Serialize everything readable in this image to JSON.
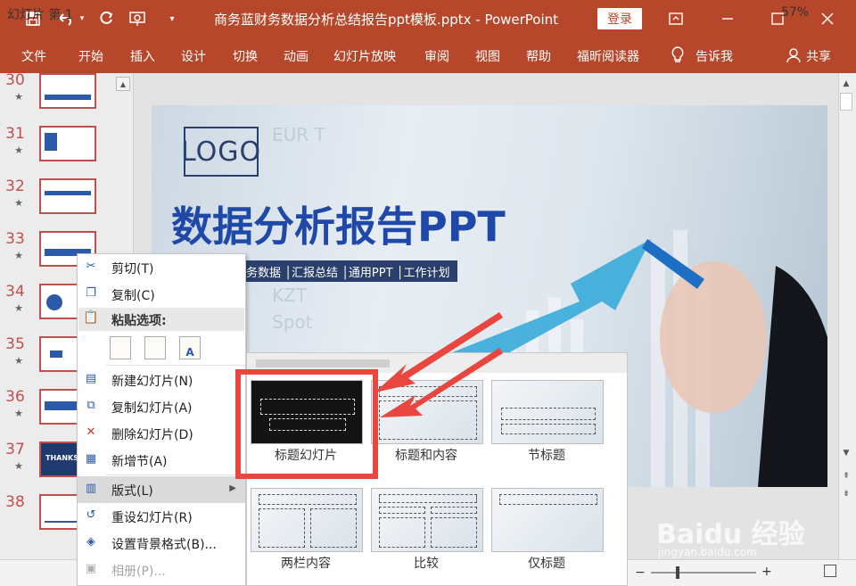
{
  "titlebar": {
    "doc_title": "商务蓝财务数据分析总结报告ppt模板.pptx  -  PowerPoint",
    "login": "登录",
    "icons": [
      "save-icon",
      "undo-icon",
      "redo-icon",
      "present-icon",
      "customize-icon"
    ]
  },
  "ribbon": {
    "tabs": [
      "文件",
      "开始",
      "插入",
      "设计",
      "切换",
      "动画",
      "幻灯片放映",
      "审阅",
      "视图",
      "帮助",
      "福昕阅读器"
    ],
    "tell_me": "告诉我",
    "share": "共享"
  },
  "thumbnails": [
    {
      "num": "30"
    },
    {
      "num": "31"
    },
    {
      "num": "32"
    },
    {
      "num": "33"
    },
    {
      "num": "34"
    },
    {
      "num": "35"
    },
    {
      "num": "36"
    },
    {
      "num": "37",
      "text": "THANKS"
    },
    {
      "num": "38"
    }
  ],
  "slide": {
    "logo": "LOGO",
    "title": "数据分析报告PPT",
    "tags": "务数据 │汇报总结 │通用PPT │工作计划"
  },
  "context_menu": {
    "items": [
      {
        "label": "剪切(T)",
        "icon": "scissors-icon"
      },
      {
        "label": "复制(C)",
        "icon": "copy-icon"
      },
      {
        "label": "粘贴选项:",
        "icon": "paste-icon"
      },
      {
        "label": "新建幻灯片(N)",
        "icon": "new-slide-icon"
      },
      {
        "label": "复制幻灯片(A)",
        "icon": "duplicate-slide-icon"
      },
      {
        "label": "删除幻灯片(D)",
        "icon": "delete-slide-icon"
      },
      {
        "label": "新增节(A)",
        "icon": "add-section-icon"
      },
      {
        "label": "版式(L)",
        "icon": "layout-icon"
      },
      {
        "label": "重设幻灯片(R)",
        "icon": "reset-slide-icon"
      },
      {
        "label": "设置背景格式(B)...",
        "icon": "format-background-icon"
      },
      {
        "label": "相册(P)...",
        "icon": "photo-album-icon"
      }
    ],
    "paste_icons": [
      "paste-keep-theme-icon",
      "paste-keep-format-icon",
      "paste-text-only-icon"
    ],
    "paste_icon_glyphs": [
      "",
      "",
      "A"
    ]
  },
  "gallery": {
    "layouts": [
      "标题幻灯片",
      "标题和内容",
      "节标题",
      "两栏内容",
      "比较",
      "仅标题"
    ],
    "selected": "标题幻灯片"
  },
  "statusbar": {
    "slide_info": "幻灯片 第 1",
    "zoom": "57%"
  },
  "watermark": {
    "brand": "Baidu 经验",
    "url": "jingyan.baidu.com"
  }
}
